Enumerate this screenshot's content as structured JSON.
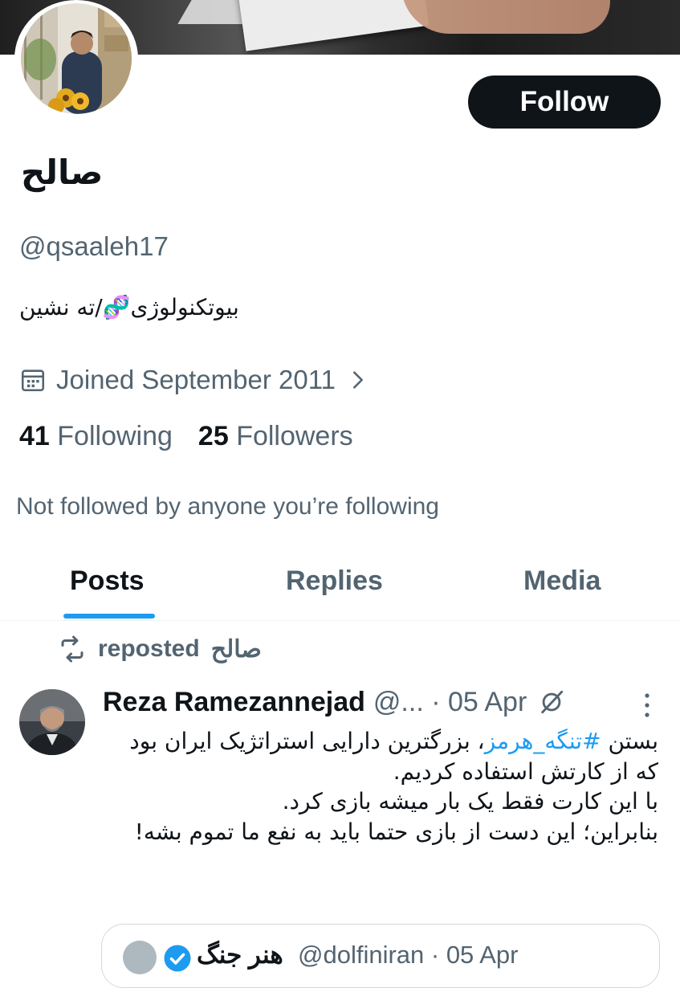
{
  "profile": {
    "follow_label": "Follow",
    "display_name": "صالح",
    "handle": "@qsaaleh17",
    "bio": "بیوتکنولوژی🧬/ته نشین",
    "joined": "Joined September 2011",
    "following_count": "41",
    "following_label": "Following",
    "followers_count": "25",
    "followers_label": "Followers",
    "not_followed": "Not followed by anyone you’re following"
  },
  "tabs": [
    {
      "label": "Posts",
      "active": true
    },
    {
      "label": "Replies",
      "active": false
    },
    {
      "label": "Media",
      "active": false
    }
  ],
  "post": {
    "repost_label": "reposted",
    "reposter": "صالح",
    "author": "Reza Ramezannejad",
    "meta": "@... · 05 Apr",
    "text_before_hashtag": "بستن ",
    "hashtag": "#تنگه_هرمز",
    "text_after_hashtag": "، بزرگترین دارایی استراتژیک ایران بود که از کارتش استفاده کردیم.",
    "line2": "با این کارت فقط یک بار میشه بازی کرد.",
    "line3": "بنابراین؛ این دست از بازی حتما باید به نفع ما تموم بشه!",
    "quote": {
      "name": "هنر جنگ",
      "meta": "@dolfiniran · 05 Apr"
    }
  },
  "colors": {
    "accent": "#1d9bf0",
    "text_primary": "#0f1419",
    "text_secondary": "#536471",
    "button_bg": "#0f1419"
  }
}
